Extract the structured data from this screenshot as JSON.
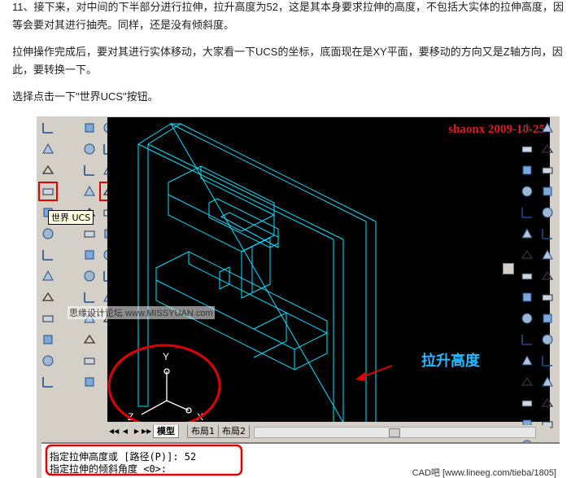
{
  "article": {
    "p1": "11、接下来，对中间的下半部分进行拉伸，拉升高度为52，这是其本身要求拉伸的高度，不包括大实体的拉伸高度，因等会要对其进行抽壳。同样，还是没有倾斜度。",
    "p2": "拉伸操作完成后，要对其进行实体移动，大家看一下UCS的坐标，底面现在是XY平面，要移动的方向又是Z轴方向，因此，要转换一下。",
    "p3": "选择点击一下\"世界UCS\"按钮。"
  },
  "screenshot": {
    "watermark": "shaonx 2009-10-25",
    "tooltip": "世界 UCS",
    "site_watermark": "思缘设计论坛 www.MISSYUAN.com",
    "annotation_label": "拉升高度",
    "axes": {
      "x": "X",
      "y": "Y",
      "z": "Z"
    },
    "tabs": [
      "模型",
      "布局1",
      "布局2"
    ],
    "command_lines": [
      "指定拉伸高度或 [路径(P)]: 52",
      "指定拉伸的倾斜角度 <0>:"
    ],
    "footer": "CAD吧 [www.lineeg.com/tieba/1805]"
  },
  "icons": {
    "left_col_1": [
      "ucs-icon",
      "ucs-view-icon",
      "ucs-prev-icon",
      "world-ucs-icon",
      "ucs-origin-icon",
      "ucs-zaxis-icon",
      "ucs-3point-icon",
      "ucs-object-icon",
      "ucs-face-icon",
      "ucs-x-icon",
      "ucs-y-icon",
      "ucs-z-icon",
      "ucs-apply-icon"
    ],
    "left_col_2": [
      "union-icon",
      "box-icon",
      "wedge-icon",
      "extrude-icon",
      "revolve-icon",
      "slice-icon",
      "section-icon",
      "interfere-icon",
      "setup-icon",
      "shade-icon",
      "render-icon",
      "light-icon",
      "material-icon"
    ],
    "right_col_1": [
      "line-icon",
      "xline-icon",
      "polyline-icon",
      "polygon-icon",
      "rectangle-icon",
      "arc-icon",
      "circle-icon",
      "revcloud-icon",
      "spline-icon",
      "ellipse-icon",
      "ellipse-arc-icon",
      "insert-icon",
      "block-icon",
      "point-icon",
      "hatch-icon",
      "region-icon",
      "table-icon",
      "text-icon"
    ],
    "right_col_2": [
      "erase-icon",
      "copy-icon",
      "mirror-icon",
      "offset-icon",
      "array-icon",
      "move-icon",
      "rotate-icon",
      "scale-icon",
      "stretch-icon",
      "trim-icon",
      "extend-icon",
      "break-icon",
      "chamfer-icon",
      "fillet-icon",
      "explode-icon"
    ]
  },
  "colors": {
    "model_lines": "#00e5ff",
    "highlight": "#e00000",
    "annotation": "#27b8ff"
  }
}
